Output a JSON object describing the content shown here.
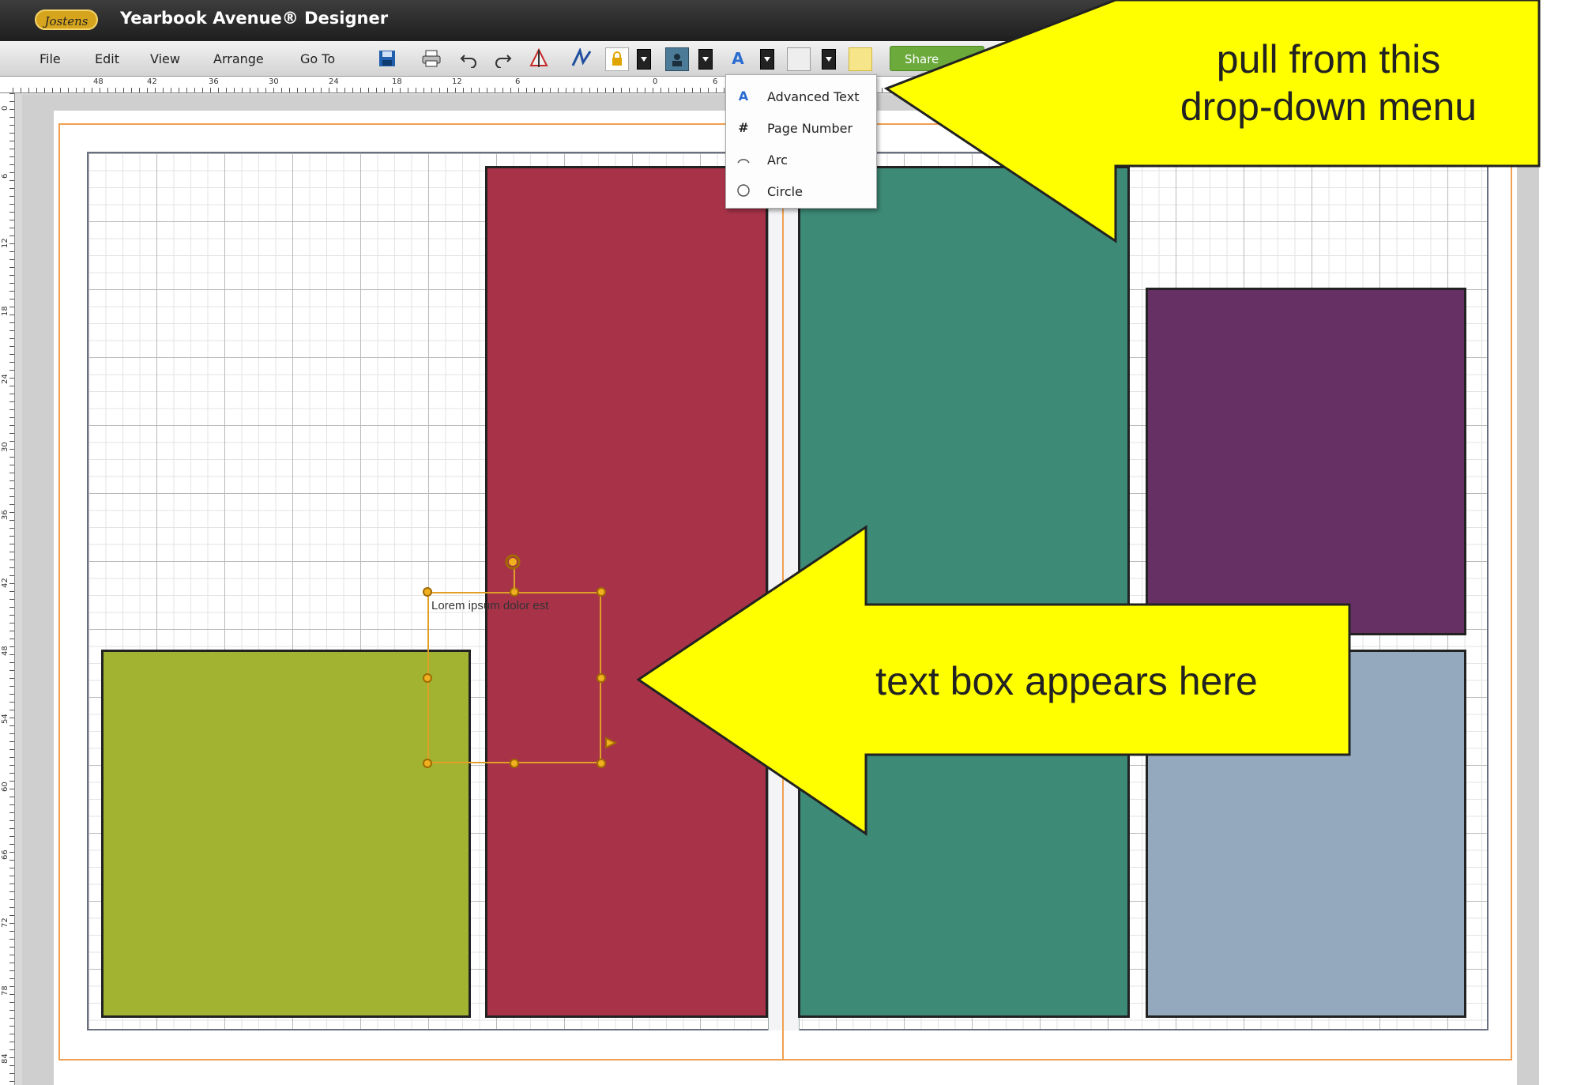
{
  "titlebar": {
    "logo_text": "Jostens",
    "app_title": "Yearbook Avenue® Designer"
  },
  "menubar": {
    "items": [
      "File",
      "Edit",
      "View",
      "Arrange",
      "Go To"
    ],
    "share_label": "Share"
  },
  "toolbar": {
    "icons": [
      "save-icon",
      "print-icon",
      "undo-icon",
      "redo-icon",
      "flip-icon",
      "signature-icon",
      "lock-icon",
      "image-icon",
      "text-icon",
      "shape-icon",
      "sticky-note-icon"
    ]
  },
  "ruler": {
    "top_labels": [
      "48",
      "42",
      "36",
      "30",
      "24",
      "18",
      "12",
      "6",
      "0",
      "6"
    ],
    "left_labels": [
      "0",
      "6",
      "12",
      "18",
      "24",
      "30",
      "36",
      "42",
      "48",
      "54",
      "60",
      "66",
      "72",
      "78",
      "84"
    ]
  },
  "dropdown_menu": {
    "items": [
      {
        "icon": "advanced-text-icon",
        "label": "Advanced Text"
      },
      {
        "icon": "hash-icon",
        "label": "Page Number"
      },
      {
        "icon": "arc-icon",
        "label": "Arc"
      },
      {
        "icon": "circle-icon",
        "label": "Circle"
      }
    ]
  },
  "canvas": {
    "blocks": [
      {
        "name": "green-photo-block",
        "color": "#a2b331"
      },
      {
        "name": "red-photo-block",
        "color": "#a83349"
      },
      {
        "name": "teal-photo-block",
        "color": "#3d8a76"
      },
      {
        "name": "purple-photo-block",
        "color": "#663064"
      },
      {
        "name": "blue-gray-photo-block",
        "color": "#94a9bd"
      }
    ],
    "textbox_text": "Lorem ipsum dolor est"
  },
  "annotations": {
    "top": "pull from this\ndrop-down menu",
    "middle": "text box appears here",
    "color": "#ffff00"
  }
}
